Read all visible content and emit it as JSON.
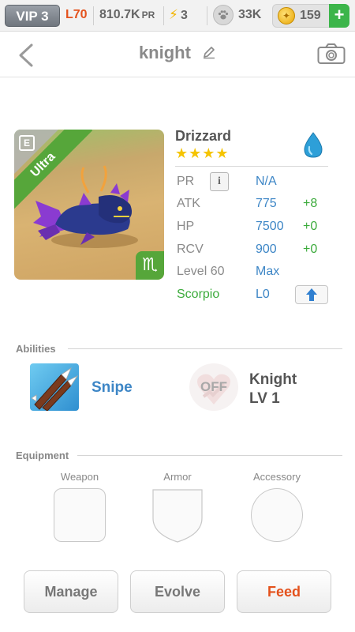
{
  "status_bar": {
    "vip": "VIP 3",
    "level": "L70",
    "pr_value": "810.7K",
    "pr_unit": "PR",
    "energy": "3",
    "paw_count": "33K",
    "coins": "159",
    "plus_label": "+"
  },
  "header": {
    "title": "knight"
  },
  "pet": {
    "name": "Drizzard",
    "rarity": "Ultra",
    "stars": "★★★★",
    "element_icon": "water-drop-icon",
    "tag_letter": "E",
    "zodiac_symbol": "♏",
    "stats": [
      {
        "label": "PR",
        "value": "N/A",
        "bonus": ""
      },
      {
        "label": "ATK",
        "value": "775",
        "bonus": "+8"
      },
      {
        "label": "HP",
        "value": "7500",
        "bonus": "+0"
      },
      {
        "label": "RCV",
        "value": "900",
        "bonus": "+0"
      },
      {
        "label": "Level 60",
        "value": "Max",
        "bonus": ""
      },
      {
        "label": "Scorpio",
        "value": "L0",
        "bonus": ""
      }
    ],
    "info_label": "i"
  },
  "abilities": {
    "heading": "Abilities",
    "primary": {
      "name": "Snipe"
    },
    "secondary": {
      "state": "OFF",
      "name": "Knight",
      "level": "LV 1"
    }
  },
  "equipment": {
    "heading": "Equipment",
    "slots": [
      "Weapon",
      "Armor",
      "Accessory"
    ]
  },
  "actions": {
    "manage": "Manage",
    "evolve": "Evolve",
    "feed": "Feed"
  },
  "colors": {
    "accent_blue": "#3d86c6",
    "bonus_green": "#3cab3c",
    "rarity_green": "#56a63a",
    "feed_orange": "#e4521d"
  }
}
